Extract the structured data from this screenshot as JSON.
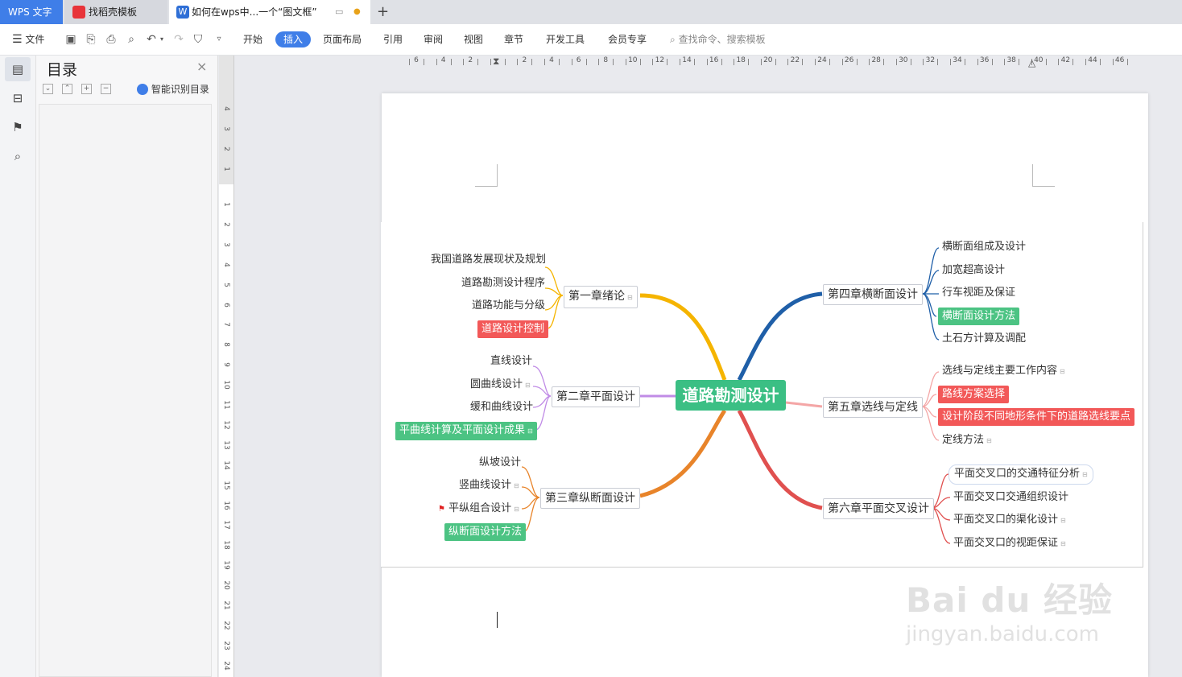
{
  "tabs": {
    "app": "WPS 文字",
    "template": "找稻壳模板",
    "document": "如何在wps中...一个“图文框”",
    "new_tab": "+"
  },
  "toolbar": {
    "file": "文件",
    "menu": [
      "开始",
      "插入",
      "页面布局",
      "引用",
      "审阅",
      "视图",
      "章节",
      "开发工具",
      "会员专享"
    ],
    "active": "插入",
    "search_placeholder": "查找命令、搜索模板"
  },
  "nav_pane": {
    "title": "目录",
    "smart_toc": "智能识别目录",
    "close": "×"
  },
  "ruler": {
    "h_ticks": [
      "6",
      "4",
      "2",
      "",
      "2",
      "4",
      "6",
      "8",
      "10",
      "12",
      "14",
      "16",
      "18",
      "20",
      "22",
      "24",
      "26",
      "28",
      "30",
      "32",
      "34",
      "36",
      "38",
      "40",
      "42",
      "44",
      "46"
    ],
    "v_ticks_top": [
      "4",
      "3",
      "2",
      "1"
    ],
    "v_ticks": [
      "1",
      "2",
      "3",
      "4",
      "5",
      "6",
      "7",
      "8",
      "9",
      "10",
      "11",
      "12",
      "13",
      "14",
      "15",
      "16",
      "17",
      "18",
      "19",
      "20",
      "21",
      "22",
      "23",
      "24"
    ]
  },
  "mindmap": {
    "root": "道路勘测设计",
    "ch1": {
      "title": "第一章绪论",
      "items": [
        "我国道路发展现状及规划",
        "道路勘测设计程序",
        "道路功能与分级",
        "道路设计控制"
      ]
    },
    "ch2": {
      "title": "第二章平面设计",
      "items": [
        "直线设计",
        "圆曲线设计",
        "缓和曲线设计",
        "平曲线计算及平面设计成果"
      ]
    },
    "ch3": {
      "title": "第三章纵断面设计",
      "items": [
        "纵坡设计",
        "竖曲线设计",
        "平纵组合设计",
        "纵断面设计方法"
      ]
    },
    "ch4": {
      "title": "第四章横断面设计",
      "items": [
        "横断面组成及设计",
        "加宽超高设计",
        "行车视距及保证",
        "横断面设计方法",
        "土石方计算及调配"
      ]
    },
    "ch5": {
      "title": "第五章选线与定线",
      "items": [
        "选线与定线主要工作内容",
        "路线方案选择",
        "设计阶段不同地形条件下的道路选线要点",
        "定线方法"
      ]
    },
    "ch6": {
      "title": "第六章平面交叉设计",
      "items": [
        "平面交叉口的交通特征分析",
        "平面交叉口交通组织设计",
        "平面交叉口的渠化设计",
        "平面交叉口的视距保证"
      ]
    },
    "colors": {
      "ch1": "#f5b400",
      "ch2": "#c08be6",
      "ch3": "#e8842a",
      "ch4": "#1f5fa8",
      "ch5": "#f4a6a6",
      "ch6": "#e0504f",
      "red": "#f25858",
      "green": "#4cc383"
    }
  },
  "watermark": {
    "line1": "Bai du 经验",
    "line2": "jingyan.baidu.com"
  }
}
